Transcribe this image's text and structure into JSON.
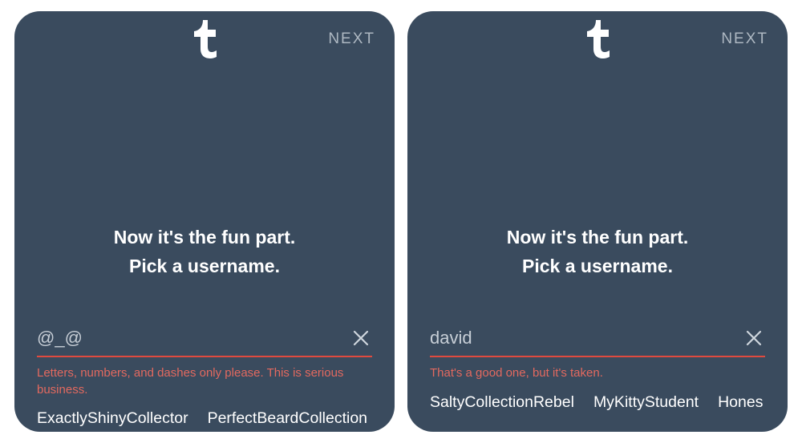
{
  "colors": {
    "panel_bg": "#3a4b5e",
    "error": "#e04a3f",
    "error_text": "#e3695f",
    "muted": "#aeb8c2"
  },
  "screens": [
    {
      "header": {
        "next_label": "NEXT"
      },
      "headline": {
        "line1": "Now it's the fun part.",
        "line2": "Pick a username."
      },
      "field": {
        "value": "@_@",
        "has_clear": true,
        "error": "Letters, numbers, and dashes only please. This is serious business."
      },
      "suggestions": [
        "ExactlyShinyCollector",
        "PerfectBeardCollection"
      ]
    },
    {
      "header": {
        "next_label": "NEXT"
      },
      "headline": {
        "line1": "Now it's the fun part.",
        "line2": "Pick a username."
      },
      "field": {
        "value": "david",
        "has_clear": true,
        "error": "That's a good one, but it's taken."
      },
      "suggestions": [
        "SaltyCollectionRebel",
        "MyKittyStudent",
        "Hones"
      ]
    }
  ]
}
